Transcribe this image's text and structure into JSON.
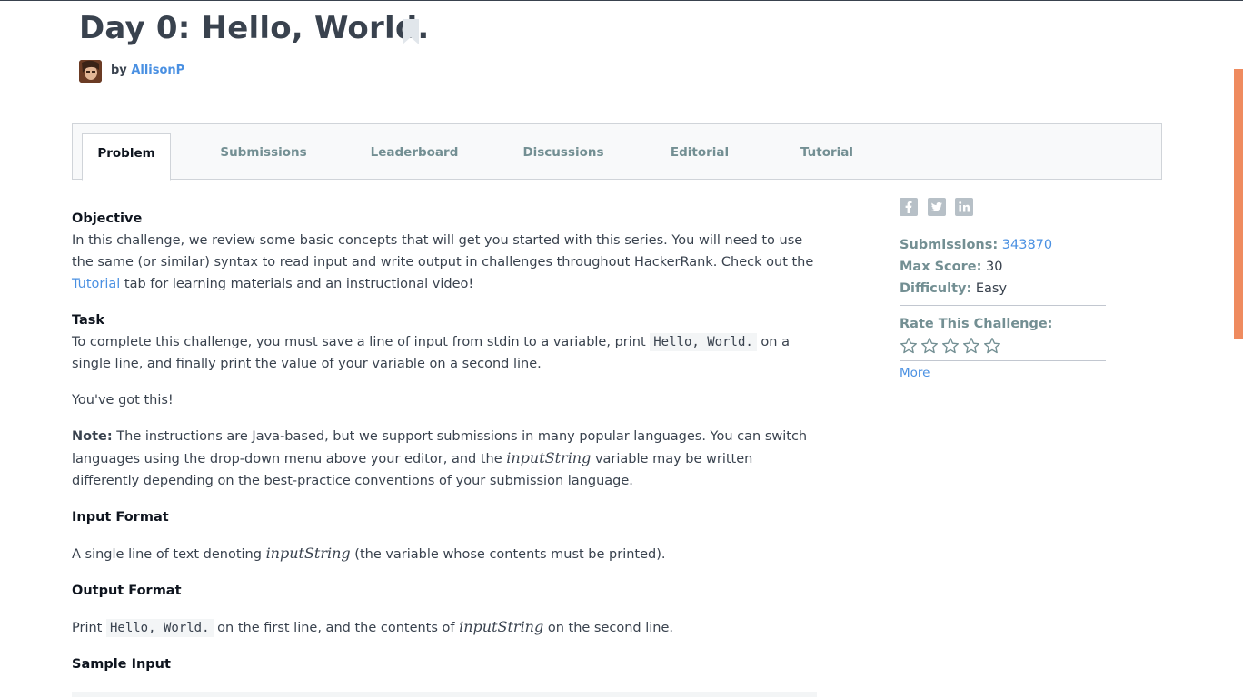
{
  "header": {
    "title": "Day 0: Hello, World.",
    "by_prefix": "by",
    "author": "AllisonP"
  },
  "tabs": [
    {
      "label": "Problem",
      "active": true
    },
    {
      "label": "Submissions"
    },
    {
      "label": "Leaderboard"
    },
    {
      "label": "Discussions"
    },
    {
      "label": "Editorial"
    },
    {
      "label": "Tutorial"
    }
  ],
  "content": {
    "objective": {
      "heading": "Objective",
      "text_1": "In this challenge, we review some basic concepts that will get you started with this series. You will need to use the same (or similar) syntax to read input and write output in challenges throughout HackerRank. Check out the ",
      "link": "Tutorial",
      "text_2": " tab for learning materials and an instructional video!"
    },
    "task": {
      "heading": "Task",
      "text_1": "To complete this challenge, you must save a line of input from stdin to a variable, print ",
      "code": "Hello, World.",
      "text_2": " on a single line, and finally print the value of your variable on a second line."
    },
    "encouragement": "You've got this!",
    "note": {
      "label": "Note:",
      "text_1": " The instructions are Java-based, but we support submissions in many popular languages. You can switch languages using the drop-down menu above your editor, and the ",
      "math": "inputString",
      "text_2": " variable may be written differently depending on the best-practice conventions of your submission language."
    },
    "input_format": {
      "heading": "Input Format",
      "text_1": "A single line of text denoting ",
      "math": "inputString",
      "text_2": " (the variable whose contents must be printed)."
    },
    "output_format": {
      "heading": "Output Format",
      "text_1": "Print ",
      "code": "Hello, World.",
      "text_2": " on the first line, and the contents of ",
      "math": "inputString",
      "text_3": " on the second line."
    },
    "sample_input": {
      "heading": "Sample Input"
    }
  },
  "sidebar": {
    "share_icons": [
      "facebook-icon",
      "twitter-icon",
      "linkedin-icon"
    ],
    "submissions_label": "Submissions:",
    "submissions_value": "343870",
    "max_score_label": "Max Score:",
    "max_score_value": "30",
    "difficulty_label": "Difficulty:",
    "difficulty_value": "Easy",
    "rate_label": "Rate This Challenge:",
    "rating_stars": 5,
    "more_label": "More"
  },
  "colors": {
    "link": "#4a90e2",
    "text": "#39424e",
    "muted": "#738f93",
    "scroll_thumb": "#ef8b5f"
  }
}
